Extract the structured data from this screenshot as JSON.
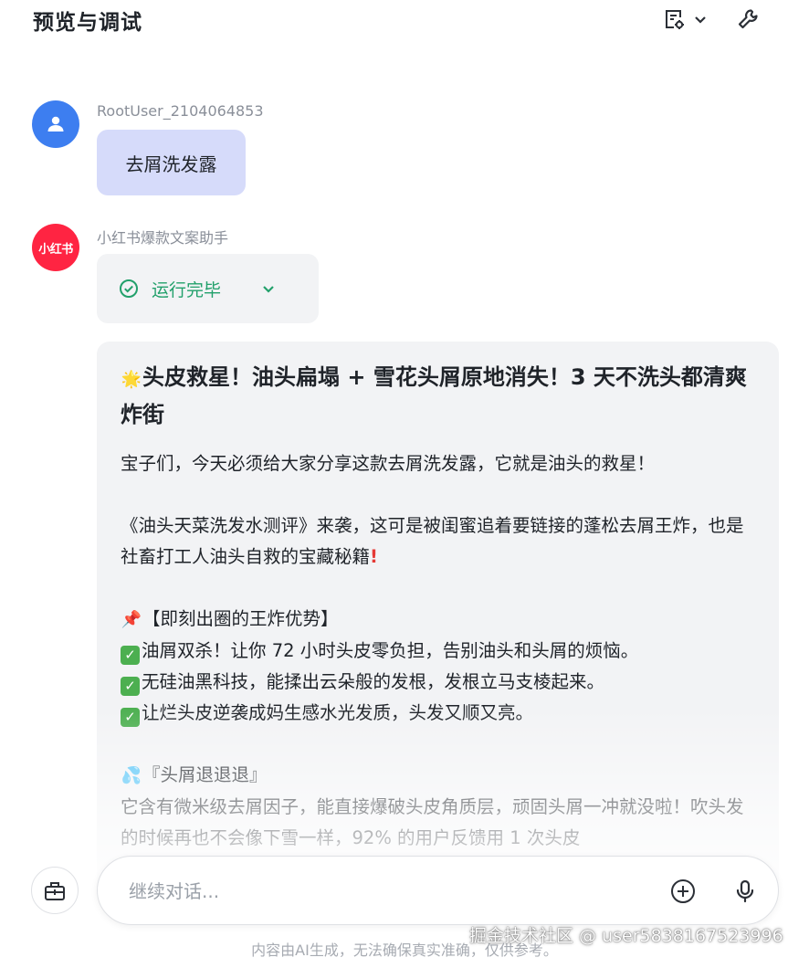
{
  "header": {
    "title": "预览与调试",
    "doc_icon": "doc-settings-icon",
    "tool_icon": "wrench-icon"
  },
  "user_message": {
    "sender": "RootUser_2104064853",
    "text": "去屑洗发露"
  },
  "bot": {
    "sender": "小红书爆款文案助手",
    "avatar_text": "小红书",
    "brand_color": "#ff2442",
    "run_status": "运行完毕",
    "answer": {
      "title": "头皮救星！油头扁塌 + 雪花头屑原地消失！3 天不洗头都清爽炸街",
      "p1": "宝子们，今天必须给大家分享这款去屑洗发露，它就是油头的救星！",
      "p2": "《油头天菜洗发水测评》来袭，这可是被闺蜜追着要链接的蓬松去屑王炸，也是社畜打工人油头自救的宝藏秘籍",
      "section1": "【即刻出圈的王炸优势】",
      "bullets": [
        "油屑双杀！让你 72 小时头皮零负担，告别油头和头屑的烦恼。",
        "无硅油黑科技，能揉出云朵般的发根，发根立马支棱起来。",
        "让烂头皮逆袭成妈生感水光发质，头发又顺又亮。"
      ],
      "section2": "『头屑退退退』",
      "p3": "它含有微米级去屑因子，能直接爆破头皮角质层，顽固头屑一冲就没啦！吹头发的时候再也不会像下雪一样，92% 的用户反馈用 1 次头皮"
    }
  },
  "input": {
    "placeholder": "继续对话..."
  },
  "footer": {
    "disclaimer": "内容由AI生成，无法确保真实准确，仅供参考。",
    "watermark": "掘金技术社区 @ user5838167523996"
  },
  "colors": {
    "user_bubble": "#d6dbfa",
    "success": "#22a06b",
    "avatar_user": "#3d7ef0"
  }
}
